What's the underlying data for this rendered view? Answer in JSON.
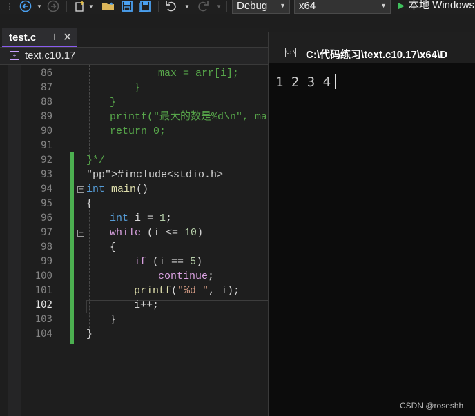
{
  "toolbar": {
    "config": "Debug",
    "platform": "x64",
    "run_label": "本地 Windows"
  },
  "tab": {
    "title": "test.c",
    "pin": "⊣",
    "close": "✕"
  },
  "navbar": {
    "scope": "text.c10.17"
  },
  "editor": {
    "current_line": 102,
    "lines": [
      {
        "n": "86",
        "code": "max = arr[i];"
      },
      {
        "n": "87",
        "code": "}"
      },
      {
        "n": "88",
        "code": "}"
      },
      {
        "n": "89",
        "code": "printf(\"最大的数是%d\\n\", max"
      },
      {
        "n": "90",
        "code": "return 0;"
      },
      {
        "n": "91",
        "code": ""
      },
      {
        "n": "92",
        "code": "}*/"
      },
      {
        "n": "93",
        "code": "#include<stdio.h>"
      },
      {
        "n": "94",
        "code": "int main()"
      },
      {
        "n": "95",
        "code": "{"
      },
      {
        "n": "96",
        "code": "int i = 1;"
      },
      {
        "n": "97",
        "code": "while (i <= 10)"
      },
      {
        "n": "98",
        "code": "{"
      },
      {
        "n": "99",
        "code": "if (i == 5)"
      },
      {
        "n": "100",
        "code": "continue;"
      },
      {
        "n": "101",
        "code": "printf(\"%d \", i);"
      },
      {
        "n": "102",
        "code": "i++;"
      },
      {
        "n": "103",
        "code": "}"
      },
      {
        "n": "104",
        "code": "}"
      }
    ]
  },
  "console": {
    "title": "C:\\代码练习\\text.c10.17\\x64\\D",
    "icon_label": "C:\\",
    "output": "1 2 3 4"
  },
  "watermark": "CSDN @roseshh",
  "colors": {
    "accent": "#8a5cf0",
    "change_bar": "#4caf50",
    "run_icon": "#3fbf5c"
  }
}
